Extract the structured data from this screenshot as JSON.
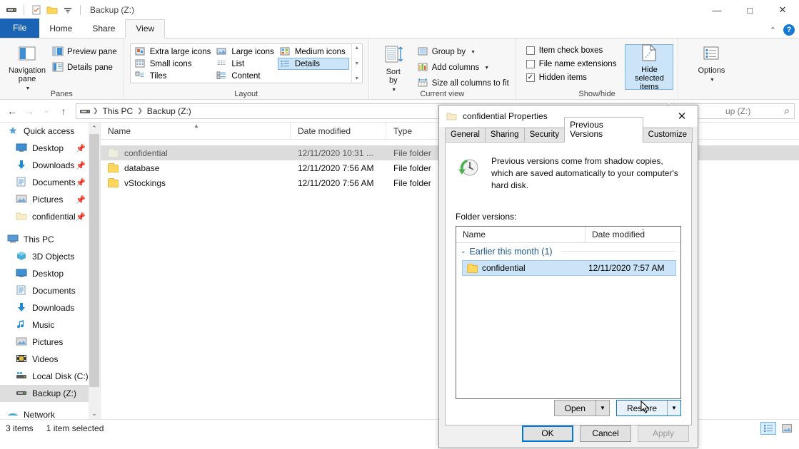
{
  "window": {
    "title": "Backup (Z:)",
    "quick_access": [
      "drive-icon",
      "properties-icon",
      "new-folder-icon",
      "customize-caret"
    ],
    "controls": {
      "minimize": "—",
      "maximize": "□",
      "close": "✕"
    },
    "ribbon_collapse": "⌃",
    "help": "?"
  },
  "ribbon": {
    "tabs": [
      {
        "label": "File",
        "active": false
      },
      {
        "label": "Home",
        "active": false
      },
      {
        "label": "Share",
        "active": false
      },
      {
        "label": "View",
        "active": true
      }
    ],
    "groups": {
      "panes": {
        "label": "Panes",
        "navigation_pane": "Navigation\npane",
        "navigation_pane_label": "Navigation pane",
        "preview_pane": "Preview pane",
        "details_pane": "Details pane"
      },
      "layout": {
        "label": "Layout",
        "items": [
          {
            "label": "Extra large icons",
            "selected": false
          },
          {
            "label": "Large icons",
            "selected": false
          },
          {
            "label": "Medium icons",
            "selected": false
          },
          {
            "label": "Small icons",
            "selected": false
          },
          {
            "label": "List",
            "selected": false
          },
          {
            "label": "Details",
            "selected": true
          },
          {
            "label": "Tiles",
            "selected": false
          },
          {
            "label": "Content",
            "selected": false
          }
        ]
      },
      "current_view": {
        "label": "Current view",
        "sort_by": "Sort\nby",
        "sort_by_label": "Sort by",
        "group_by": "Group by",
        "add_columns": "Add columns",
        "size_all_columns": "Size all columns to fit"
      },
      "show_hide": {
        "label": "Show/hide",
        "item_check_boxes": {
          "label": "Item check boxes",
          "checked": false
        },
        "file_name_extensions": {
          "label": "File name extensions",
          "checked": false
        },
        "hidden_items": {
          "label": "Hidden items",
          "checked": true
        },
        "hide_selected_items": "Hide selected items"
      },
      "options": {
        "label": "Options"
      }
    }
  },
  "address_bar": {
    "back": "←",
    "forward": "→",
    "recent": "⌄",
    "up": "↑",
    "breadcrumbs": [
      "This PC",
      "Backup (Z:)"
    ],
    "separator": "❯",
    "search_placeholder": "Search Backup (Z:)",
    "search_visible_text": "up (Z:)",
    "search_icon": "⌕"
  },
  "navigation_pane": {
    "sections": [
      {
        "title": "Quick access",
        "icon": "star-icon",
        "items": [
          {
            "label": "Desktop",
            "icon": "desktop-icon",
            "pinned": true
          },
          {
            "label": "Downloads",
            "icon": "download-icon",
            "pinned": true
          },
          {
            "label": "Documents",
            "icon": "documents-icon",
            "pinned": true
          },
          {
            "label": "Pictures",
            "icon": "pictures-icon",
            "pinned": true
          },
          {
            "label": "confidential",
            "icon": "folder-icon",
            "pinned": true
          }
        ]
      },
      {
        "title": "This PC",
        "icon": "pc-icon",
        "items": [
          {
            "label": "3D Objects",
            "icon": "3d-objects-icon",
            "pinned": false
          },
          {
            "label": "Desktop",
            "icon": "desktop-icon",
            "pinned": false
          },
          {
            "label": "Documents",
            "icon": "documents-icon",
            "pinned": false
          },
          {
            "label": "Downloads",
            "icon": "download-icon",
            "pinned": false
          },
          {
            "label": "Music",
            "icon": "music-icon",
            "pinned": false
          },
          {
            "label": "Pictures",
            "icon": "pictures-icon",
            "pinned": false
          },
          {
            "label": "Videos",
            "icon": "videos-icon",
            "pinned": false
          },
          {
            "label": "Local Disk (C:)",
            "icon": "disk-icon",
            "pinned": false
          },
          {
            "label": "Backup (Z:)",
            "icon": "drive-icon",
            "pinned": false,
            "selected": true
          }
        ]
      },
      {
        "title": "Network",
        "icon": "network-icon",
        "items": []
      }
    ]
  },
  "file_list": {
    "columns": [
      "Name",
      "Date modified",
      "Type"
    ],
    "sort_column": "Name",
    "rows": [
      {
        "name": "confidential",
        "date_modified": "12/11/2020 10:31 ...",
        "type": "File folder",
        "selected": true,
        "hidden": true
      },
      {
        "name": "database",
        "date_modified": "12/11/2020 7:56 AM",
        "type": "File folder",
        "selected": false,
        "hidden": false
      },
      {
        "name": "vStockings",
        "date_modified": "12/11/2020 7:56 AM",
        "type": "File folder",
        "selected": false,
        "hidden": false
      }
    ]
  },
  "status_bar": {
    "item_count": "3 items",
    "selection": "1 item selected",
    "view_details": "details-view-button",
    "view_thumbnails": "thumbnail-view-button"
  },
  "dialog": {
    "title": "confidential Properties",
    "close": "✕",
    "tabs": [
      {
        "label": "General",
        "active": false
      },
      {
        "label": "Sharing",
        "active": false
      },
      {
        "label": "Security",
        "active": false
      },
      {
        "label": "Previous Versions",
        "active": true
      },
      {
        "label": "Customize",
        "active": false
      }
    ],
    "info_text": "Previous versions come from shadow copies, which are saved automatically to your computer's hard disk.",
    "folder_versions_label": "Folder versions:",
    "version_columns": [
      "Name",
      "Date modified"
    ],
    "version_group": "Earlier this month (1)",
    "versions": [
      {
        "name": "confidential",
        "date_modified": "12/11/2020 7:57 AM",
        "selected": true
      }
    ],
    "open_button": "Open",
    "restore_button": "Restore",
    "dropdown_arrow": "▼",
    "ok_button": "OK",
    "cancel_button": "Cancel",
    "apply_button": "Apply"
  },
  "colors": {
    "accent": "#0078d7",
    "file_tab": "#1b64b5",
    "selection": "#cce4f7",
    "row_selection": "#dcdcdc",
    "folder_yellow": "#ffd75e"
  }
}
